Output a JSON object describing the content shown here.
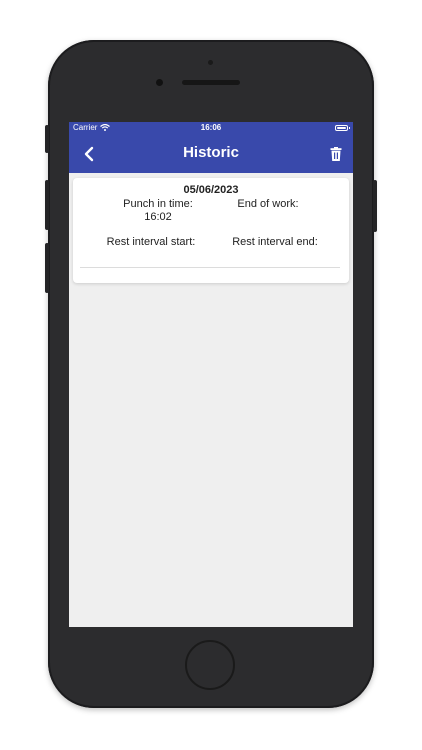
{
  "status_bar": {
    "carrier": "Carrier",
    "time": "16:06"
  },
  "app_bar": {
    "title": "Historic",
    "back_icon": "chevron-left-icon",
    "delete_icon": "trash-icon"
  },
  "record": {
    "date": "05/06/2023",
    "punch_in_label": "Punch in time:",
    "punch_in_value": "16:02",
    "end_of_work_label": "End of work:",
    "end_of_work_value": "",
    "rest_start_label": "Rest interval start:",
    "rest_end_label": "Rest interval end:"
  },
  "colors": {
    "primary": "#3949ab",
    "background": "#efefef",
    "card": "#ffffff"
  }
}
